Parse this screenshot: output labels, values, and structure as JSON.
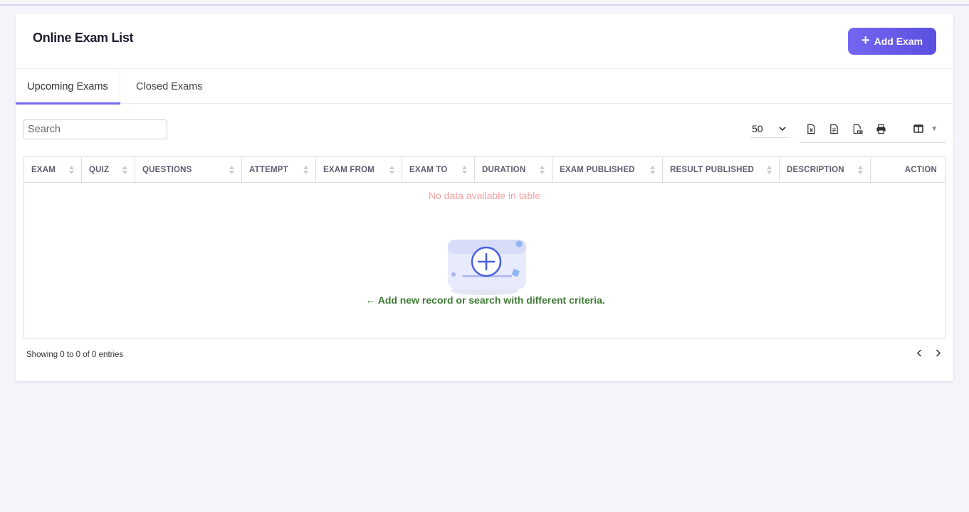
{
  "header": {
    "title": "Online Exam List",
    "add_button_label": "Add Exam"
  },
  "tabs": [
    {
      "label": "Upcoming Exams",
      "active": true
    },
    {
      "label": "Closed Exams",
      "active": false
    }
  ],
  "toolbar": {
    "search_placeholder": "Search",
    "page_length": "50",
    "export_icons": [
      "excel-icon",
      "csv-icon",
      "pdf-icon",
      "print-icon"
    ],
    "column_toggle_icon": "columns-icon"
  },
  "table": {
    "columns": [
      "EXAM",
      "QUIZ",
      "QUESTIONS",
      "ATTEMPT",
      "EXAM FROM",
      "EXAM TO",
      "DURATION",
      "EXAM PUBLISHED",
      "RESULT PUBLISHED",
      "DESCRIPTION",
      "ACTION"
    ],
    "rows": [],
    "empty_message": "No data available in table",
    "hint": "Add new record or search with different criteria."
  },
  "footer": {
    "info": "Showing 0 to 0 of 0 entries"
  },
  "colors": {
    "accent": "#7367f0",
    "empty_text": "#f3a1a1",
    "hint_text": "#3f7a34"
  }
}
